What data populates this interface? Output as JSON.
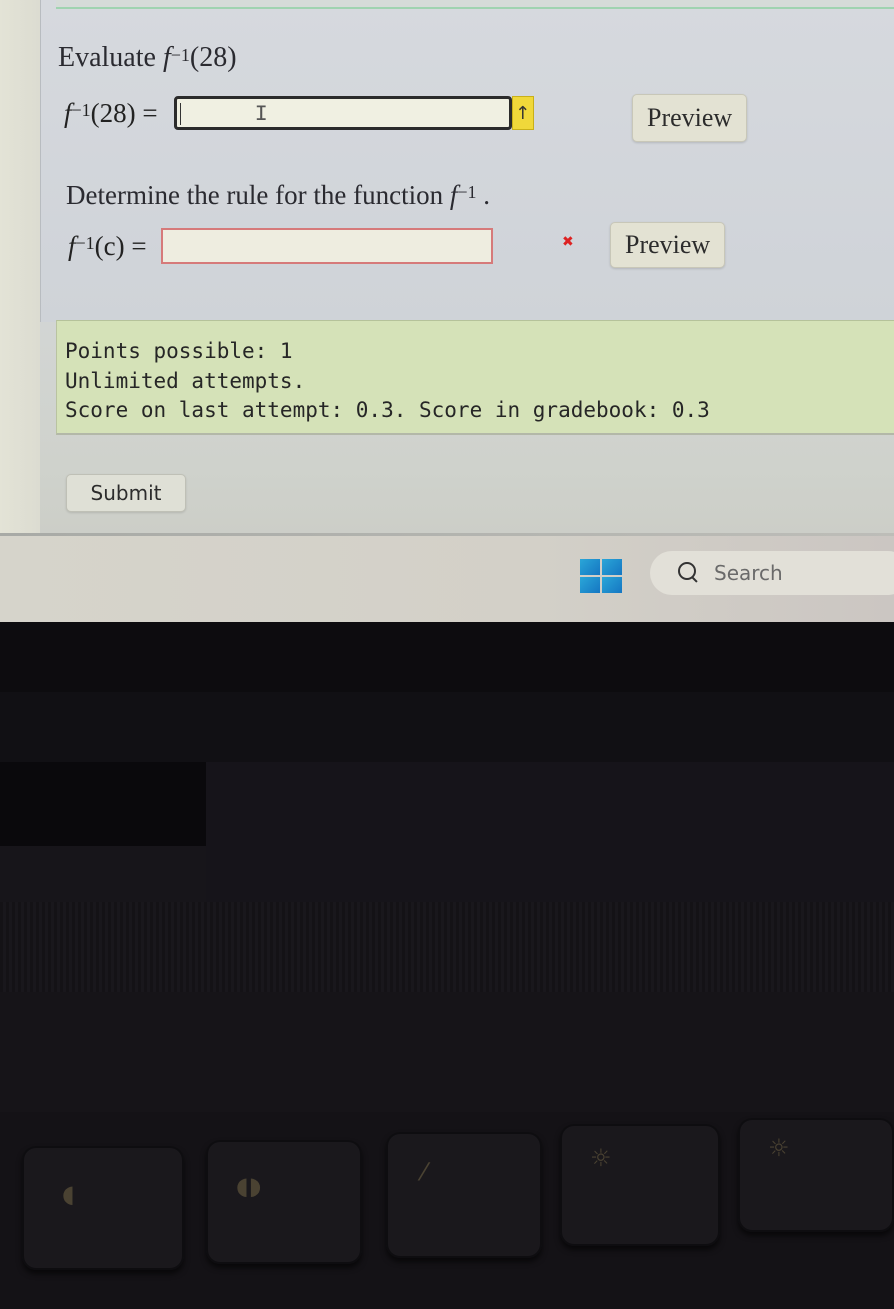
{
  "question_1": {
    "prompt_text": "Evaluate",
    "function_symbol": "f",
    "inverse_exponent": "−1",
    "prompt_argument": "(28)",
    "answer_lhs_argument": "(28)",
    "equals": "=",
    "answer_value": "",
    "answer_placeholder": "",
    "warning_icon": "up-arrow",
    "warning_glyph": "↑",
    "preview_label": "Preview"
  },
  "question_2": {
    "prompt_text": "Determine the rule for the function",
    "function_symbol": "f",
    "inverse_exponent": "−1",
    "prompt_suffix": ".",
    "answer_lhs_argument": "(c)",
    "equals": "=",
    "answer_value": "",
    "answer_placeholder": "",
    "status_icon": "incorrect-x",
    "status_glyph": "✖",
    "preview_label": "Preview"
  },
  "points_panel": {
    "points_possible": "Points possible: 1",
    "attempts": "Unlimited attempts.",
    "score": "Score on last attempt: 0.3. Score in gradebook: 0.3"
  },
  "actions": {
    "submit_label": "Submit"
  },
  "taskbar": {
    "start_icon": "windows-logo",
    "search_label": "Search"
  },
  "colors": {
    "points_panel_bg": "#d5e2b8",
    "warning_yellow": "#f0d83a",
    "incorrect_red": "#d22222",
    "windows_blue": "#1e8fd0"
  },
  "keyboard": {
    "function_key_glyphs": [
      "◖",
      "◖◗",
      "⁄",
      "☼",
      "☼"
    ]
  }
}
